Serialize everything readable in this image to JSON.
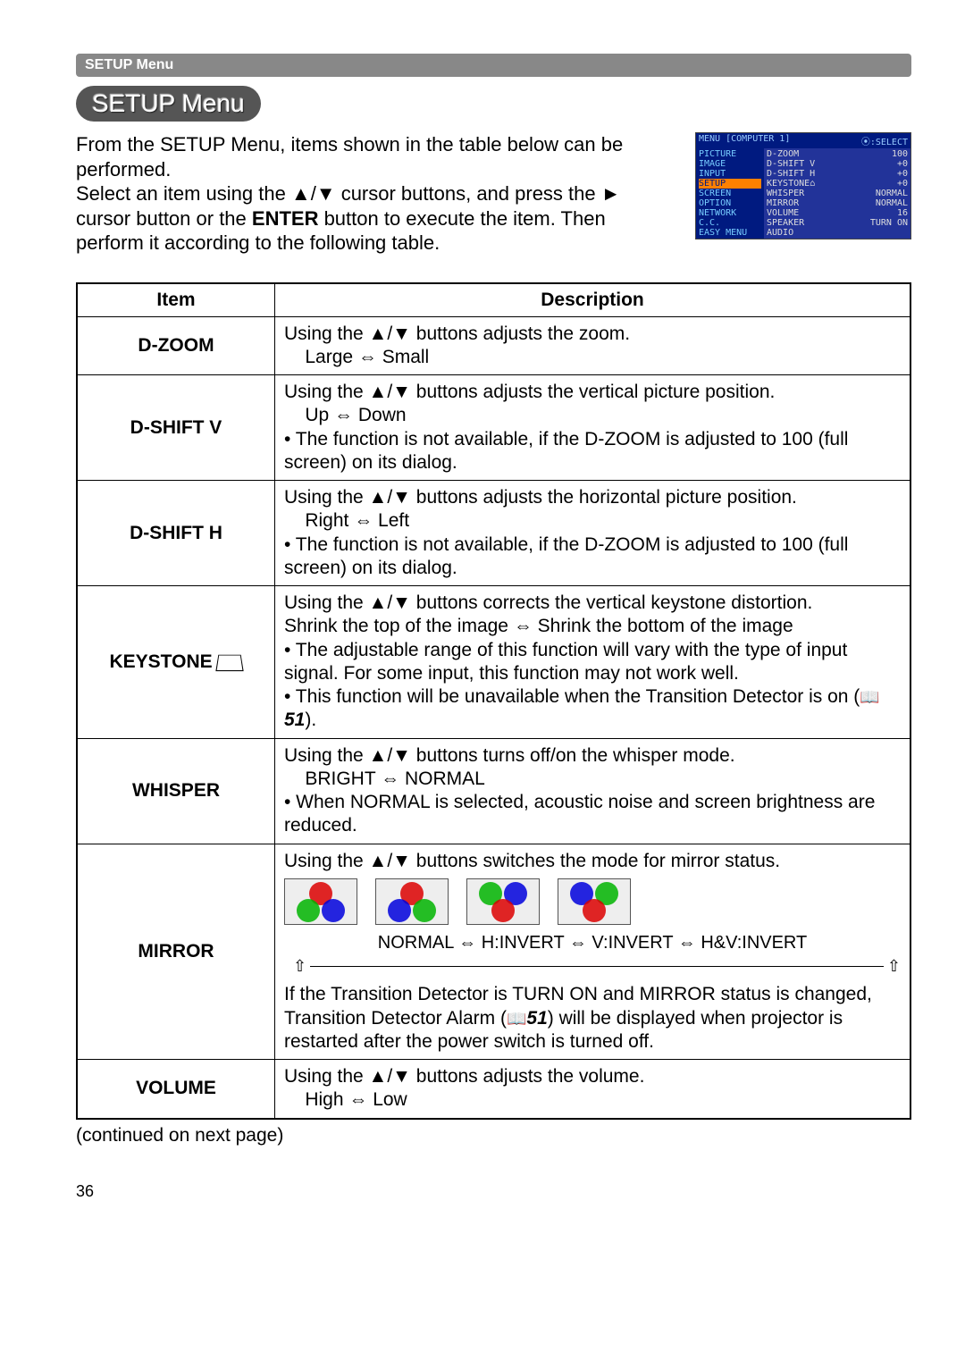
{
  "header_bar": "SETUP Menu",
  "title": "SETUP Menu",
  "intro": "From the SETUP Menu, items shown in the table below can be performed.\nSelect an item using the ▲/▼ cursor buttons, and press the ► cursor button or the ENTER button to execute the item. Then perform it according to the following table.",
  "intro_bold": "ENTER",
  "menu_shot": {
    "title_left": "MENU [COMPUTER 1]",
    "title_right": "⦿:SELECT",
    "left_items": [
      "PICTURE",
      "IMAGE",
      "INPUT",
      "SETUP",
      "SCREEN",
      "OPTION",
      "NETWORK",
      "C.C.",
      "EASY MENU"
    ],
    "selected_left": "SETUP",
    "right_rows": [
      {
        "name": "D-ZOOM",
        "val": "100"
      },
      {
        "name": "D-SHIFT V",
        "val": "+0"
      },
      {
        "name": "D-SHIFT H",
        "val": "+0"
      },
      {
        "name": "KEYSTONE⌂",
        "val": "+0"
      },
      {
        "name": "WHISPER",
        "val": "NORMAL"
      },
      {
        "name": "MIRROR",
        "val": "NORMAL"
      },
      {
        "name": "VOLUME",
        "val": "16"
      },
      {
        "name": "SPEAKER",
        "val": "TURN ON"
      },
      {
        "name": "AUDIO",
        "val": ""
      }
    ]
  },
  "table": {
    "head_item": "Item",
    "head_desc": "Description",
    "rows": [
      {
        "item": "D-ZOOM",
        "desc_lines": [
          "Using the ▲/▼ buttons adjusts the zoom.",
          "    Large ⇔ Small"
        ]
      },
      {
        "item": "D-SHIFT V",
        "desc_lines": [
          "Using the ▲/▼ buttons adjusts the vertical picture position.",
          "    Up ⇔ Down",
          "• The function is not available, if the D-ZOOM is adjusted to 100 (full screen) on its dialog."
        ]
      },
      {
        "item": "D-SHIFT H",
        "desc_lines": [
          "Using the ▲/▼ buttons adjusts the horizontal picture position.",
          "    Right ⇔ Left",
          "• The function is not available, if the D-ZOOM is adjusted to 100 (full screen) on its dialog."
        ]
      },
      {
        "item": "KEYSTONE",
        "keystone_icon": true,
        "desc_lines": [
          "Using the ▲/▼ buttons corrects the vertical keystone distortion.",
          "Shrink the top of the image ⇔ Shrink the bottom of the image",
          "• The adjustable range of this function will vary with the type of input signal. For some input, this function may not work well.",
          "• This function will be unavailable when the Transition Detector is on (📖51)."
        ],
        "ref": "51"
      },
      {
        "item": "WHISPER",
        "desc_lines": [
          "Using the ▲/▼ buttons turns off/on the whisper mode.",
          "    BRIGHT ⇔ NORMAL",
          "• When NORMAL is selected, acoustic noise and screen brightness are reduced."
        ]
      },
      {
        "item": "MIRROR",
        "desc_lines_top": [
          "Using the ▲/▼ buttons switches the mode for mirror status."
        ],
        "mirror_modes": "NORMAL ⇔ H:INVERT ⇔ V:INVERT ⇔ H&V:INVERT",
        "desc_lines_bottom": [
          "If the Transition Detector is TURN ON and MIRROR status is changed, Transition Detector Alarm (📖51) will be displayed when projector is restarted after the power switch is turned off."
        ],
        "ref": "51"
      },
      {
        "item": "VOLUME",
        "desc_lines": [
          "Using the ▲/▼ buttons adjusts the volume.",
          "    High ⇔ Low"
        ]
      }
    ]
  },
  "continued": "(continued on next page)",
  "page_number": "36"
}
